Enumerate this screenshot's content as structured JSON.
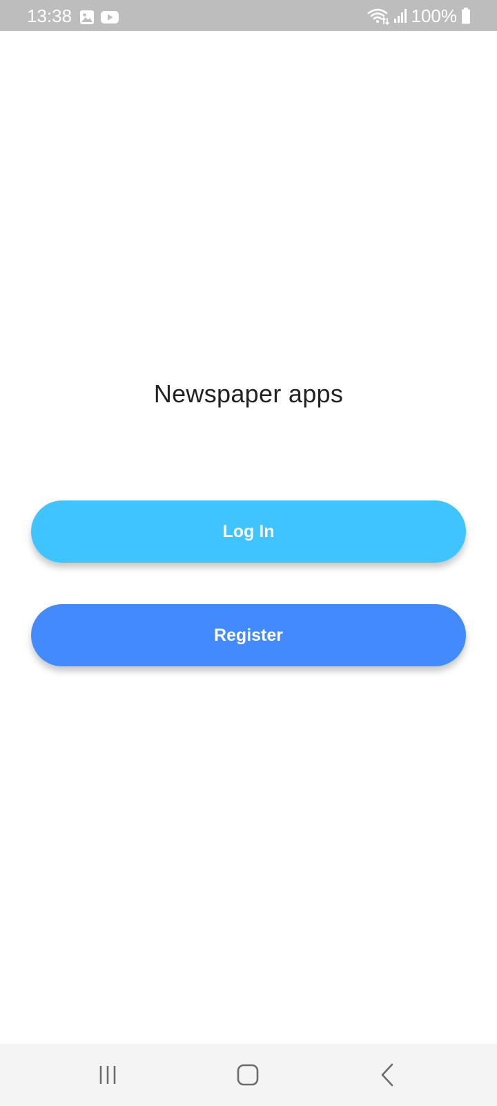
{
  "status_bar": {
    "time": "13:38",
    "battery_percent": "100%",
    "left_icons": [
      "gallery-icon",
      "youtube-icon"
    ],
    "right_icons": [
      "wifi-icon",
      "signal-icon",
      "battery-icon"
    ]
  },
  "main": {
    "title": "Newspaper apps",
    "login_label": "Log In",
    "register_label": "Register"
  },
  "colors": {
    "status_bar_bg": "#bdbdbd",
    "login_button": "#40c4ff",
    "register_button": "#448aff",
    "nav_bar_bg": "#f4f4f4",
    "title_text": "#222222"
  },
  "nav_bar": {
    "icons": [
      "recent-apps-icon",
      "home-icon",
      "back-icon"
    ]
  }
}
